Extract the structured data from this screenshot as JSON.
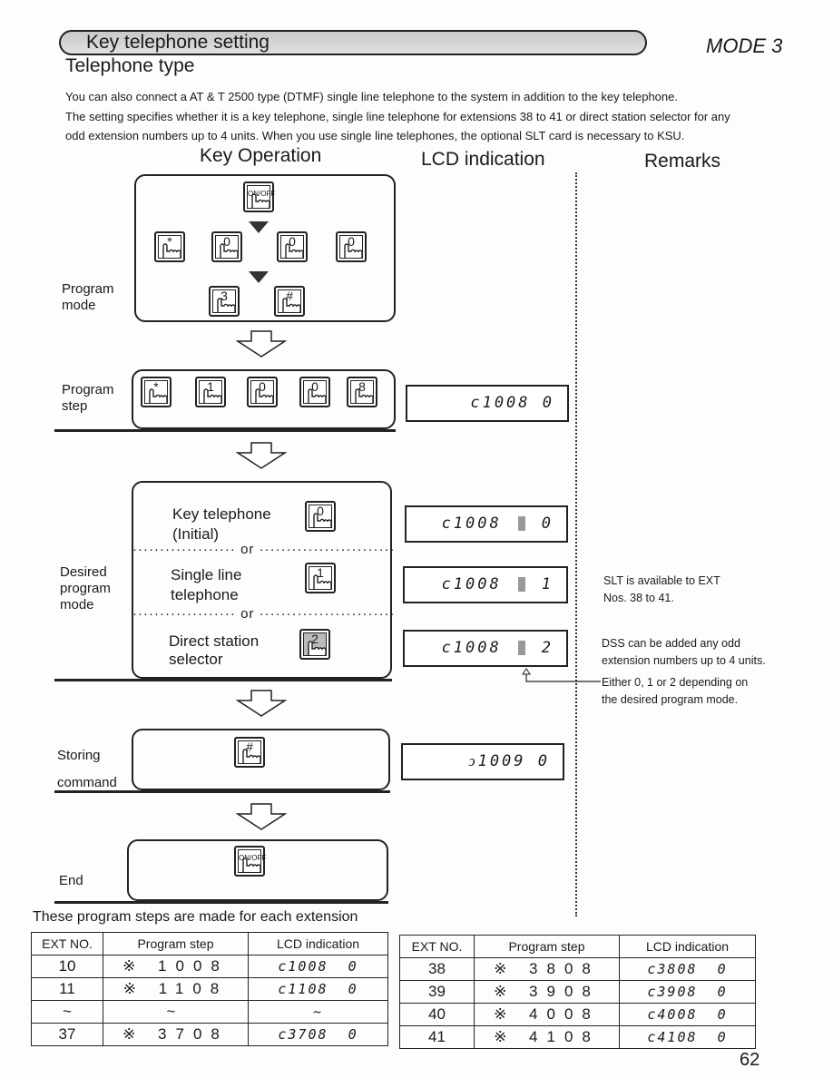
{
  "header": {
    "title": "Key telephone setting",
    "mode": "MODE 3",
    "subtitle": "Telephone type"
  },
  "intro": [
    "You can also connect a AT & T 2500 type (DTMF) single line telephone to the system in addition to the key telephone.",
    "The setting specifies whether it is a key telephone, single line telephone for extensions 38 to 41 or direct station selector for any",
    "odd extension numbers up to 4 units.  When you use single line telephones, the optional SLT card is necessary to KSU."
  ],
  "columns": {
    "key_operation": "Key Operation",
    "lcd": "LCD indication",
    "remarks": "Remarks"
  },
  "keys": {
    "onoff": "ON/OFF",
    "star": "*",
    "zero": "0",
    "one": "1",
    "two": "2",
    "three": "3",
    "eight": "8",
    "hash": "#"
  },
  "steps": {
    "program_mode": "Program mode",
    "program_step": "Program step",
    "desired": "Desired program mode",
    "storing": "Storing command",
    "end": "End",
    "options": {
      "key_tel": "Key telephone",
      "initial": "(Initial)",
      "or": "or",
      "single_line_1": "Single line",
      "single_line_2": "telephone",
      "dss_1": "Direct station",
      "dss_2": "selector"
    }
  },
  "lcd": {
    "step": "c1008 0",
    "key_prefix": "c1008",
    "key_val": "0",
    "single_val": "1",
    "dss_val": "2",
    "storing": "ↄ1009 0"
  },
  "remarks": {
    "slt_1": "SLT is available to EXT",
    "slt_2": "Nos. 38 to 41.",
    "dss_1": "DSS can be added any odd",
    "dss_2": "extension numbers up to 4 units.",
    "either_1": "Either 0, 1 or 2 depending on",
    "either_2": "the desired program mode."
  },
  "note": "These program steps are made for each extension",
  "table_headers": [
    "EXT NO.",
    "Program step",
    "LCD indication"
  ],
  "table1": [
    [
      "10",
      "※ 1008",
      "c1008  0"
    ],
    [
      "11",
      "※ 1108",
      "c1108  0"
    ],
    [
      "~",
      "~",
      "~"
    ],
    [
      "37",
      "※ 3708",
      "c3708  0"
    ]
  ],
  "table2": [
    [
      "38",
      "※ 3808",
      "c3808  0"
    ],
    [
      "39",
      "※ 3908",
      "c3908  0"
    ],
    [
      "40",
      "※ 4008",
      "c4008  0"
    ],
    [
      "41",
      "※ 4108",
      "c4108  0"
    ]
  ],
  "page_number": "62"
}
